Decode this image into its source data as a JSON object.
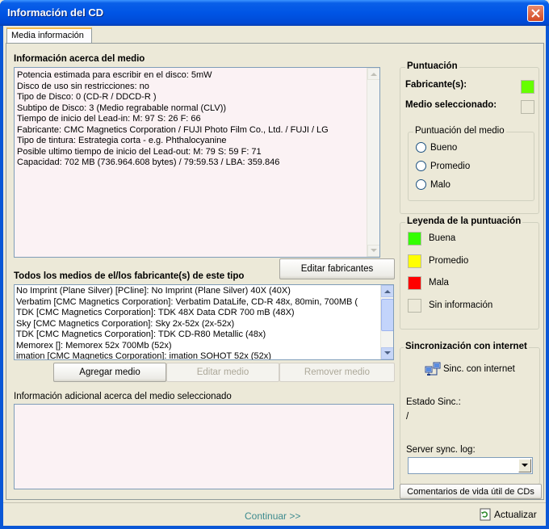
{
  "window": {
    "title": "Información del CD"
  },
  "tabs": [
    {
      "label": "Media información"
    }
  ],
  "media_info": {
    "heading": "Información acerca del medio",
    "lines": [
      "Potencia estimada para escribir en el disco: 5mW",
      "Disco de uso sin restricciones: no",
      "Tipo de Disco: 0 (CD-R / DDCD-R )",
      "Subtipo de Disco: 3 (Medio regrabable normal (CLV))",
      "Tiempo de inicio del Lead-in: M: 97 S: 26 F: 66",
      "Fabricante: CMC Magnetics Corporation / FUJI Photo Film Co., Ltd. / FUJI / LG",
      "Tipo de tintura: Estrategia corta - e.g. Phthalocyanine",
      "Posible ultimo tiempo de inicio del Lead-out: M: 79 S: 59 F: 71",
      "Capacidad: 702 MB (736.964.608 bytes) / 79:59.53 / LBA: 359.846"
    ]
  },
  "manufacturer_media": {
    "heading": "Todos los medios de el/los fabricante(s) de este tipo",
    "edit_button": "Editar fabricantes",
    "items": [
      "No Imprint (Plane Silver) [PCline]: No Imprint (Plane Silver) 40X (40X)",
      "Verbatim [CMC Magnetics Corporation]: Verbatim DataLife, CD-R 48x, 80min, 700MB (",
      "TDK [CMC Magnetics Corporation]: TDK 48X Data CDR 700 mB (48X)",
      "Sky [CMC Magnetics Corporation]: Sky 2x-52x (2x-52x)",
      "TDK [CMC Magnetics Corporation]: TDK CD-R80 Metallic (48x)",
      "Memorex []: Memorex 52x 700Mb (52x)",
      "imation [CMC Magnetics Corporation]: imation SOHOT 52x (52x)"
    ],
    "buttons": {
      "add": "Agregar medio",
      "edit": "Editar medio",
      "remove": "Remover medio"
    }
  },
  "additional_info": {
    "label": "Información adicional acerca del medio seleccionado",
    "value": ""
  },
  "rating": {
    "heading": "Puntuación",
    "manufacturer_label": "Fabricante(s):",
    "manufacturer_color": "#66FF00",
    "selected_label": "Medio seleccionado:",
    "selected_color": "#ECE9D8",
    "media_rating": {
      "heading": "Puntuación del medio",
      "options": [
        "Bueno",
        "Promedio",
        "Malo"
      ]
    }
  },
  "legend": {
    "heading": "Leyenda de la puntuación",
    "items": [
      {
        "label": "Buena",
        "color": "#33FF00"
      },
      {
        "label": "Promedio",
        "color": "#FFFF00"
      },
      {
        "label": "Mala",
        "color": "#FF0000"
      },
      {
        "label": "Sin información",
        "color": "#ECE9D8"
      }
    ]
  },
  "sync": {
    "heading": "Sincronización con internet",
    "sync_button": "Sinc. con internet",
    "status_label": "Estado Sinc.:",
    "status_value": "/",
    "server_log_label": "Server sync. log:",
    "server_log_value": "",
    "comments_button": "Comentarios de vida útil de CDs"
  },
  "footer": {
    "continue": "Continuar >>",
    "refresh": "Actualizar"
  }
}
